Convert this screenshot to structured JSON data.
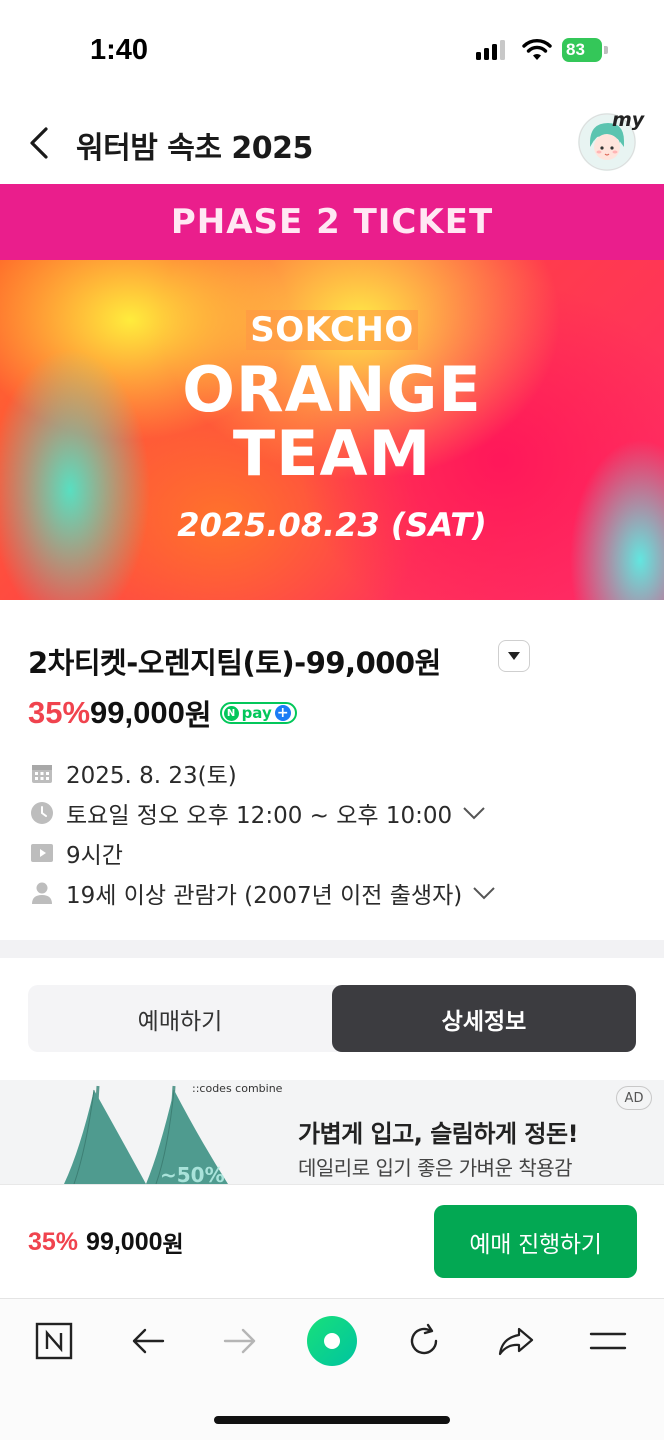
{
  "status_bar": {
    "time": "1:40",
    "battery": "83"
  },
  "header": {
    "title": "워터밤 속초 2025",
    "avatar_label": "my"
  },
  "banner": {
    "phase": "PHASE 2 TICKET",
    "city": "SOKCHO",
    "team_line1": "ORANGE",
    "team_line2": "TEAM",
    "date": "2025.08.23 (SAT)"
  },
  "product": {
    "title": "2차티켓-오렌지팀(토)-99,000원",
    "discount": "35%",
    "price": "99,000",
    "currency": "원",
    "pay_badge": "pay",
    "info": {
      "date": "2025. 8. 23(토)",
      "time": "토요일 정오 오후 12:00 ~ 오후 10:00",
      "duration": "9시간",
      "age": "19세 이상 관람가 (2007년 이전 출생자)"
    }
  },
  "tabs": {
    "reserve": "예매하기",
    "detail": "상세정보",
    "active": "detail"
  },
  "ad": {
    "brand": "::codes combine",
    "badge": "AD",
    "title": "가볍게 입고, 슬림하게 정돈!",
    "subtitle": "데일리로 입기 좋은 가벼운 착용감"
  },
  "purchase": {
    "discount": "35%",
    "price": "99,000",
    "currency": "원",
    "button": "예매 진행하기"
  },
  "colors": {
    "accent_pink": "#ea1e8c",
    "discount_red": "#f0434e",
    "naver_green": "#03a853",
    "tab_active": "#3c3c40"
  },
  "toolbar": {
    "icons": [
      "naver-home-icon",
      "back-arrow-icon",
      "forward-arrow-icon",
      "green-dot-icon",
      "refresh-icon",
      "share-icon",
      "menu-icon"
    ]
  }
}
